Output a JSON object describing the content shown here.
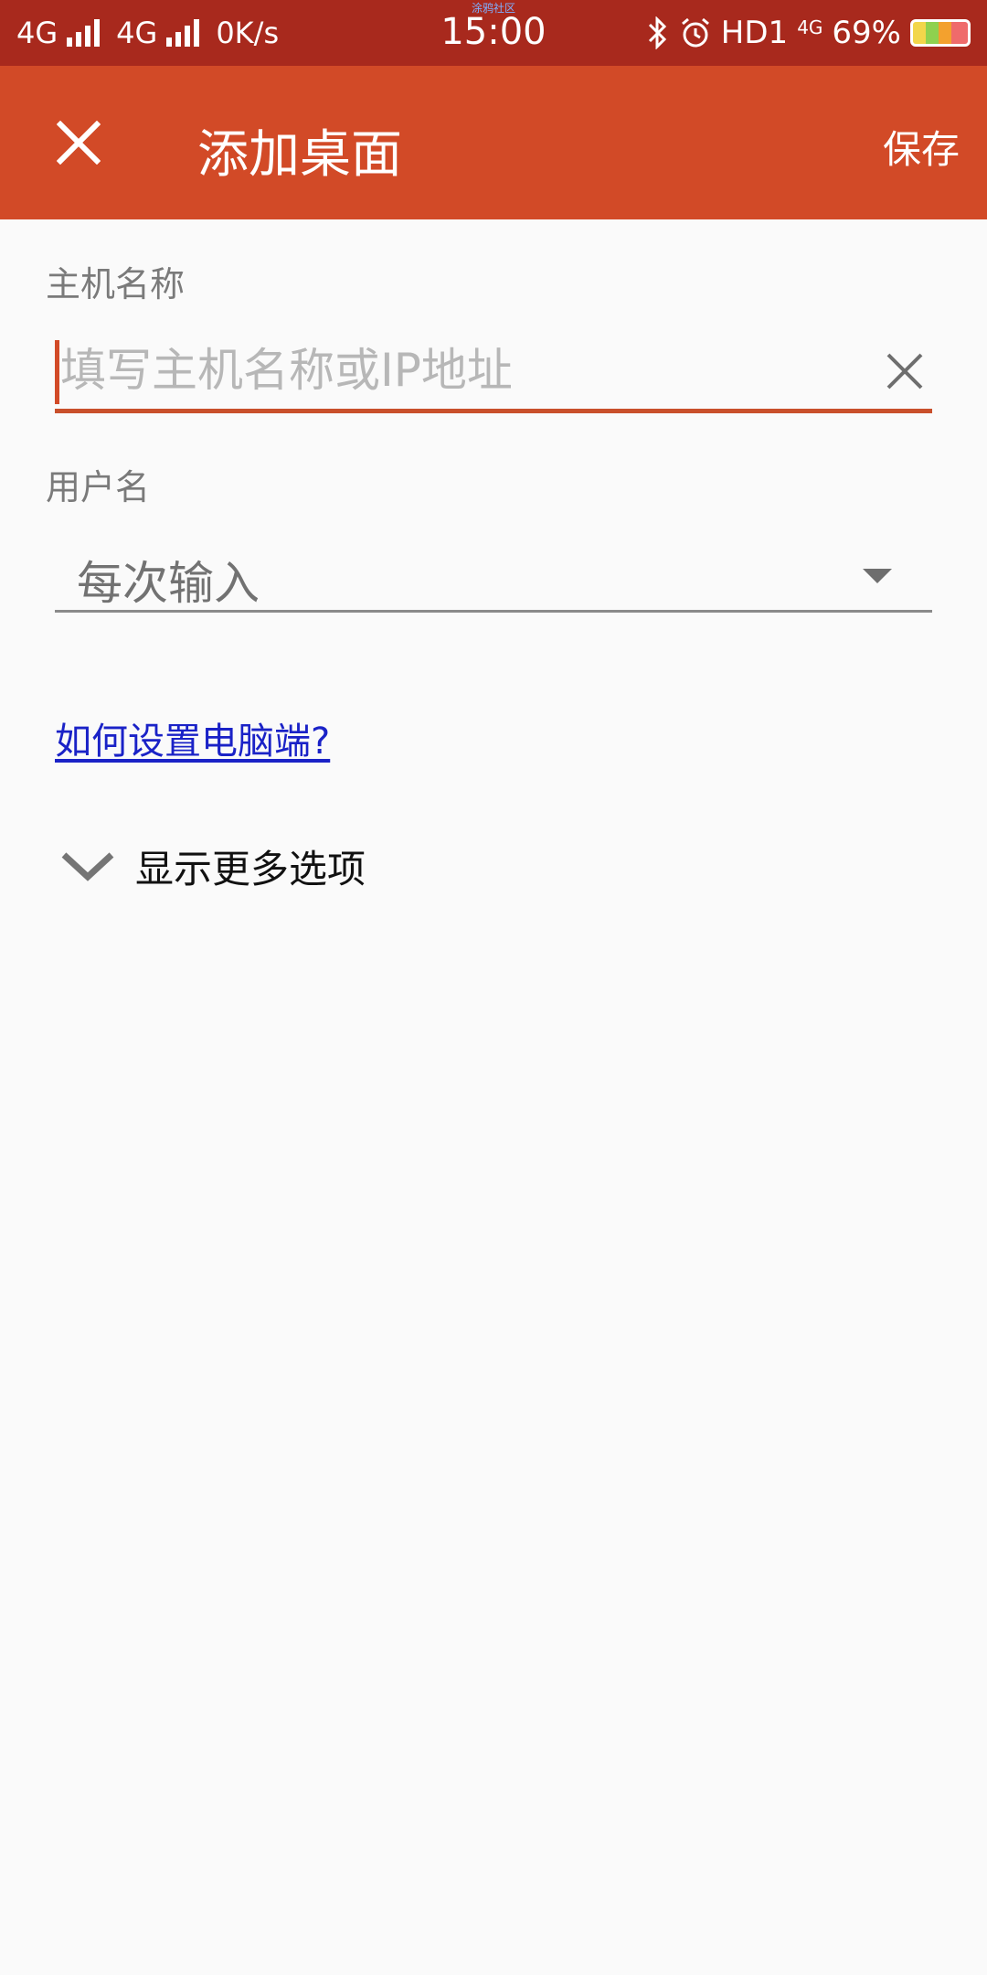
{
  "status_bar": {
    "network1": "4G",
    "network2": "4G",
    "speed": "0K/s",
    "time": "15:00",
    "tiny_text": "涂鸦社区",
    "hd": "HD1",
    "net_small": "4G",
    "battery": "69%"
  },
  "app_bar": {
    "title": "添加桌面",
    "save_label": "保存"
  },
  "form": {
    "host_label": "主机名称",
    "host_placeholder": "填写主机名称或IP地址",
    "user_label": "用户名",
    "user_value": "每次输入",
    "help_link": "如何设置电脑端?",
    "more_options": "显示更多选项"
  },
  "colors": {
    "status_bar": "#a8291d",
    "app_bar": "#d24a27",
    "link": "#1a22c7"
  },
  "icons": [
    "close-icon",
    "clear-icon",
    "dropdown-icon",
    "chevron-down-icon",
    "bluetooth-icon",
    "alarm-icon",
    "battery-icon",
    "signal-icon"
  ]
}
